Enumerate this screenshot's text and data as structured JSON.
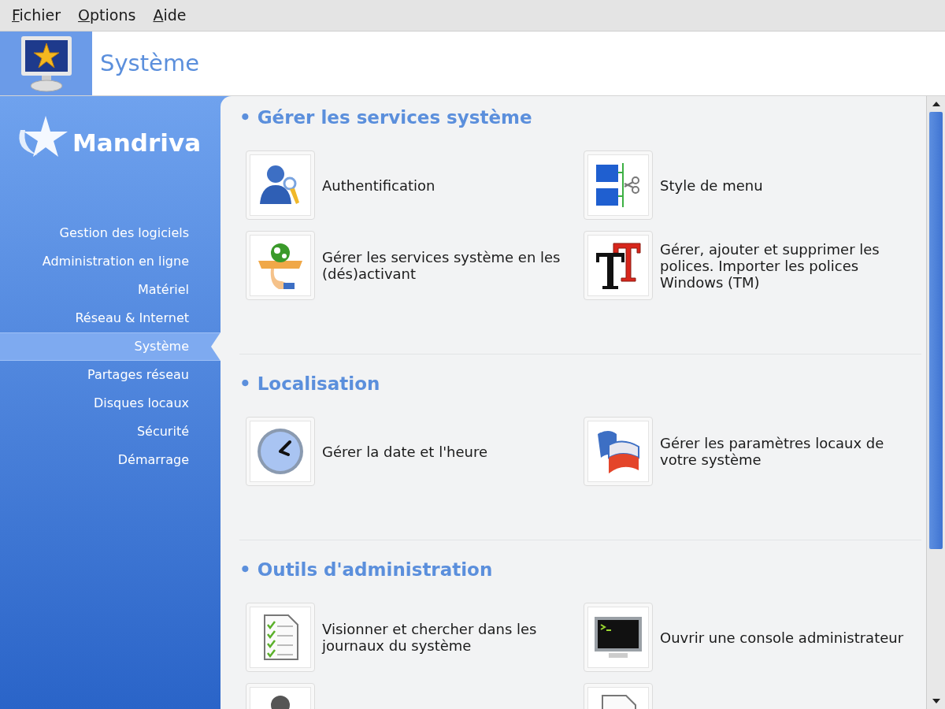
{
  "menu_bar": [
    {
      "label": "Fichier"
    },
    {
      "label": "Options"
    },
    {
      "label": "Aide"
    }
  ],
  "header": {
    "title": "Système"
  },
  "sidebar": {
    "logo_text": "Mandriva",
    "items": [
      {
        "label": "Gestion des logiciels",
        "selected": false
      },
      {
        "label": "Administration en ligne",
        "selected": false
      },
      {
        "label": "Matériel",
        "selected": false
      },
      {
        "label": "Réseau & Internet",
        "selected": false
      },
      {
        "label": "Système",
        "selected": true
      },
      {
        "label": "Partages réseau",
        "selected": false
      },
      {
        "label": "Disques locaux",
        "selected": false
      },
      {
        "label": "Sécurité",
        "selected": false
      },
      {
        "label": "Démarrage",
        "selected": false
      }
    ]
  },
  "sections": [
    {
      "bullet": "•",
      "title": "Gérer les services système",
      "items": [
        {
          "kind": "auth",
          "label": "Authentification"
        },
        {
          "kind": "menu",
          "label": "Style de menu"
        },
        {
          "kind": "services",
          "label": "Gérer les services système en les (dés)activant"
        },
        {
          "kind": "fonts",
          "label": "Gérer, ajouter et supprimer les polices. Importer les polices Windows (TM)"
        }
      ]
    },
    {
      "bullet": "•",
      "title": "Localisation",
      "items": [
        {
          "kind": "clock",
          "label": "Gérer la date et l'heure"
        },
        {
          "kind": "locale",
          "label": "Gérer les paramètres locaux de votre système"
        }
      ]
    },
    {
      "bullet": "•",
      "title": "Outils d'administration",
      "items": [
        {
          "kind": "logs",
          "label": "Visionner et chercher dans les journaux du système"
        },
        {
          "kind": "console",
          "label": "Ouvrir une console administrateur"
        },
        {
          "kind": "person"
        },
        {
          "kind": "document"
        }
      ]
    }
  ]
}
